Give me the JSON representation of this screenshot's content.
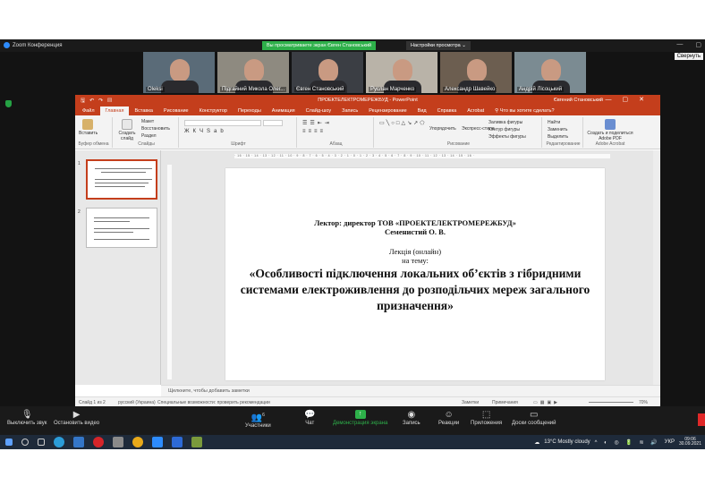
{
  "zoom": {
    "title": "Zoom Конференция",
    "viewing_text": "Вы просматриваете экран Євген Становський",
    "view_options": "Настройки просмотра",
    "collapse": "Свернуть",
    "participants": [
      {
        "name": "Oleksi"
      },
      {
        "name": "Підгайний Микола Олег..."
      },
      {
        "name": "Євген Становський"
      },
      {
        "name": "Руслан Марченко"
      },
      {
        "name": "Александр Шавейко"
      },
      {
        "name": "Андрій Лісоцький"
      }
    ],
    "toolbar": {
      "mute": "Выключить звук",
      "stop_video": "Остановить видео",
      "participants": "Участники",
      "participants_count": "6",
      "chat": "Чат",
      "share": "Демонстрация экрана",
      "record": "Запись",
      "reactions": "Реакции",
      "apps": "Приложения",
      "whiteboard": "Доски сообщений"
    }
  },
  "powerpoint": {
    "window_title": "ПРОЕКТЕЛЕКТРОМЕРЕЖБУД - PowerPoint",
    "user": "Євгений Становський",
    "tabs": [
      "Файл",
      "Главная",
      "Вставка",
      "Рисование",
      "Конструктор",
      "Переходы",
      "Анимация",
      "Слайд-шоу",
      "Запись",
      "Рецензирование",
      "Вид",
      "Справка",
      "Acrobat"
    ],
    "active_tab": "Главная",
    "tell_me": "Что вы хотите сделать?",
    "ribbon": {
      "paste": "Вставить",
      "new_slide": "Создать слайд",
      "layout": "Макет",
      "reset": "Восстановить",
      "section": "Раздел",
      "arrange": "Упорядочить",
      "quick_styles": "Экспресс-стили",
      "shape_fill": "Заливка фигуры",
      "shape_outline": "Контур фигуры",
      "shape_effects": "Эффекты фигуры",
      "find": "Найти",
      "replace": "Заменить",
      "select": "Выделить",
      "adobe": "Создать и поделиться Adobe PDF",
      "groups": {
        "clipboard": "Буфер обмена",
        "slides": "Слайды",
        "font": "Шрифт",
        "paragraph": "Абзац",
        "drawing": "Рисование",
        "editing": "Редактирование",
        "acrobat": "Adobe Acrobat"
      }
    },
    "slide": {
      "lector_line1": "Лектор: директор ТОВ «ПРОЕКТЕЛЕКТРОМЕРЕЖБУД»",
      "lector_line2": "Семенистий О. В.",
      "lecture_line1": "Лекція (онлайн)",
      "lecture_line2": "на тему:",
      "topic": "«Особливості підключення локальних об’єктів з гібридними системами електроживлення до розподільчих мереж загального призначення»"
    },
    "thumb_numbers": [
      "1",
      "2"
    ],
    "notes_placeholder": "Щелкните, чтобы добавить заметки",
    "status": {
      "slide_of": "Слайд 1 из 2",
      "language": "русский (Украина)",
      "accessibility": "Специальные возможности: проверить рекомендации",
      "notes": "Заметки",
      "comments": "Примечания",
      "zoom": "70%"
    }
  },
  "taskbar": {
    "weather": "13°C  Mostly cloudy",
    "lang": "УКР",
    "time": "09:06",
    "date": "30.09.2021"
  }
}
